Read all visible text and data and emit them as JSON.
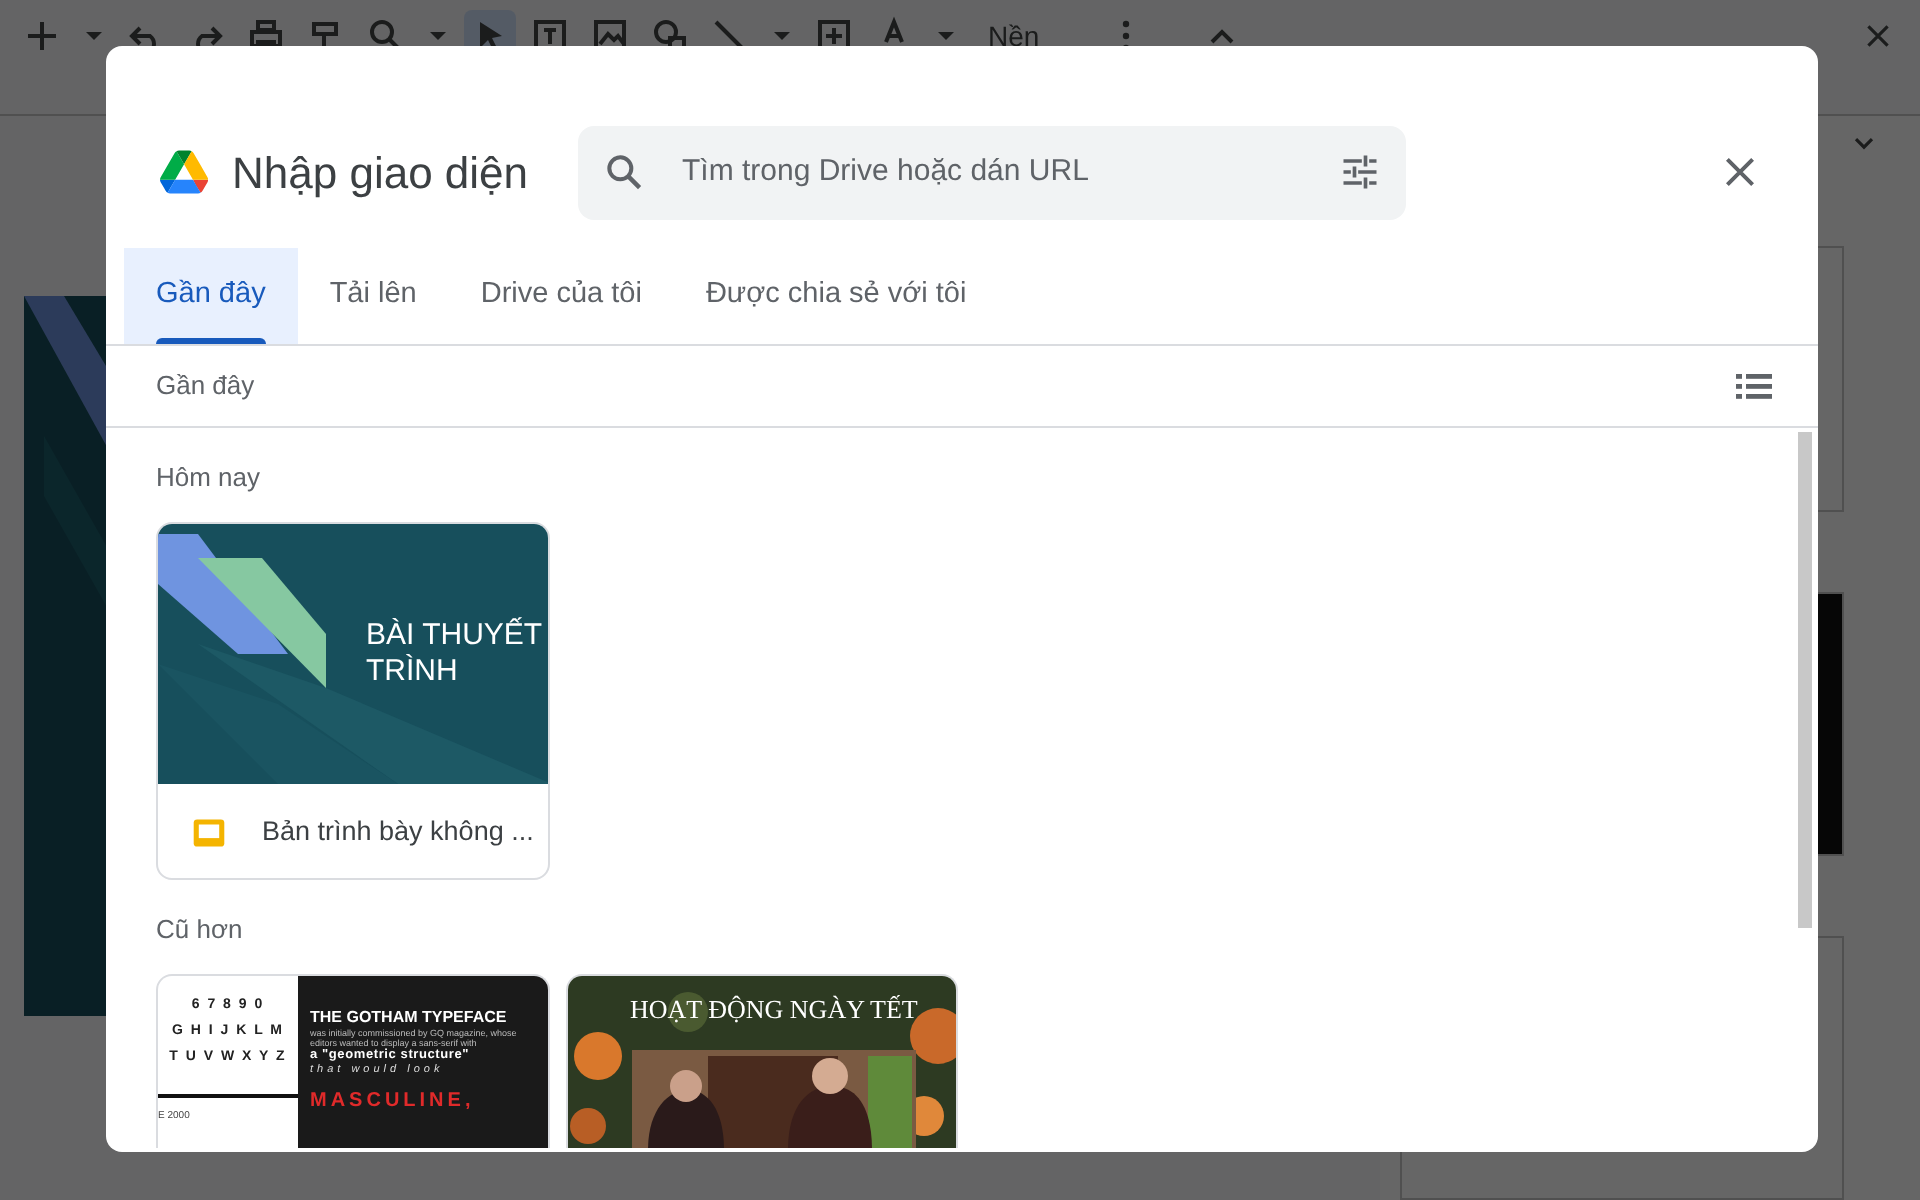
{
  "toolbar": {
    "background_button": "Nền"
  },
  "dialog": {
    "title": "Nhập giao diện",
    "search": {
      "placeholder": "Tìm trong Drive hoặc dán URL"
    },
    "tabs": [
      {
        "label": "Gần đây",
        "selected": true
      },
      {
        "label": "Tải lên",
        "selected": false
      },
      {
        "label": "Drive của tôi",
        "selected": false
      },
      {
        "label": "Được chia sẻ với tôi",
        "selected": false
      }
    ],
    "view_label": "Gần đây",
    "sections": [
      {
        "heading": "Hôm nay",
        "files": [
          {
            "kind": "title_slide",
            "title_lines": [
              "BÀI THUYẾT",
              "TRÌNH"
            ],
            "name": "Bản trình bày không ..."
          }
        ]
      },
      {
        "heading": "Cũ hơn",
        "files": [
          {
            "kind": "typeface_poster",
            "glyph_rows": [
              "6 7 8 9 0",
              "G H I J K L M",
              "T U V W X Y Z"
            ],
            "footnote": "E 2000",
            "heading": "THE GOTHAM TYPEFACE",
            "body": "was initially commissioned by GQ magazine, whose editors wanted to display a sans-serif with",
            "quote": "a \"geometric structure\"",
            "tail": "that would look",
            "banner": "MASCULINE,"
          },
          {
            "kind": "photo_slide",
            "title": "HOẠT ĐỘNG NGÀY TẾT"
          }
        ]
      }
    ]
  }
}
